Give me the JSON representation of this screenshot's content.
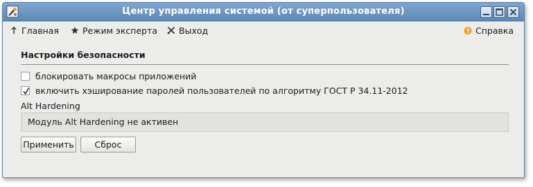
{
  "window": {
    "title": "Центр управления системой (от суперпользователя)"
  },
  "menu": {
    "home": "Главная",
    "expert": "Режим эксперта",
    "exit": "Выход",
    "help": "Справка"
  },
  "section": {
    "title": "Настройки безопасности"
  },
  "options": [
    {
      "label": "блокировать макросы приложений",
      "checked": false
    },
    {
      "label": "включить хэширование паролей пользователей по алгоритму ГОСТ Р 34.11-2012",
      "checked": true
    }
  ],
  "hardening": {
    "label": "Alt Hardening",
    "status": "Модуль Alt Hardening не активен"
  },
  "buttons": {
    "apply": "Применить",
    "reset": "Сброс"
  },
  "icons": {
    "app": "tools-icon",
    "home": "arrow-up-icon",
    "expert": "star-icon",
    "exit": "cross-icon",
    "help": "help-icon"
  },
  "colors": {
    "titlebar": "#6f97c3",
    "window_bg": "#ececea",
    "help_accent": "#f0a030"
  }
}
